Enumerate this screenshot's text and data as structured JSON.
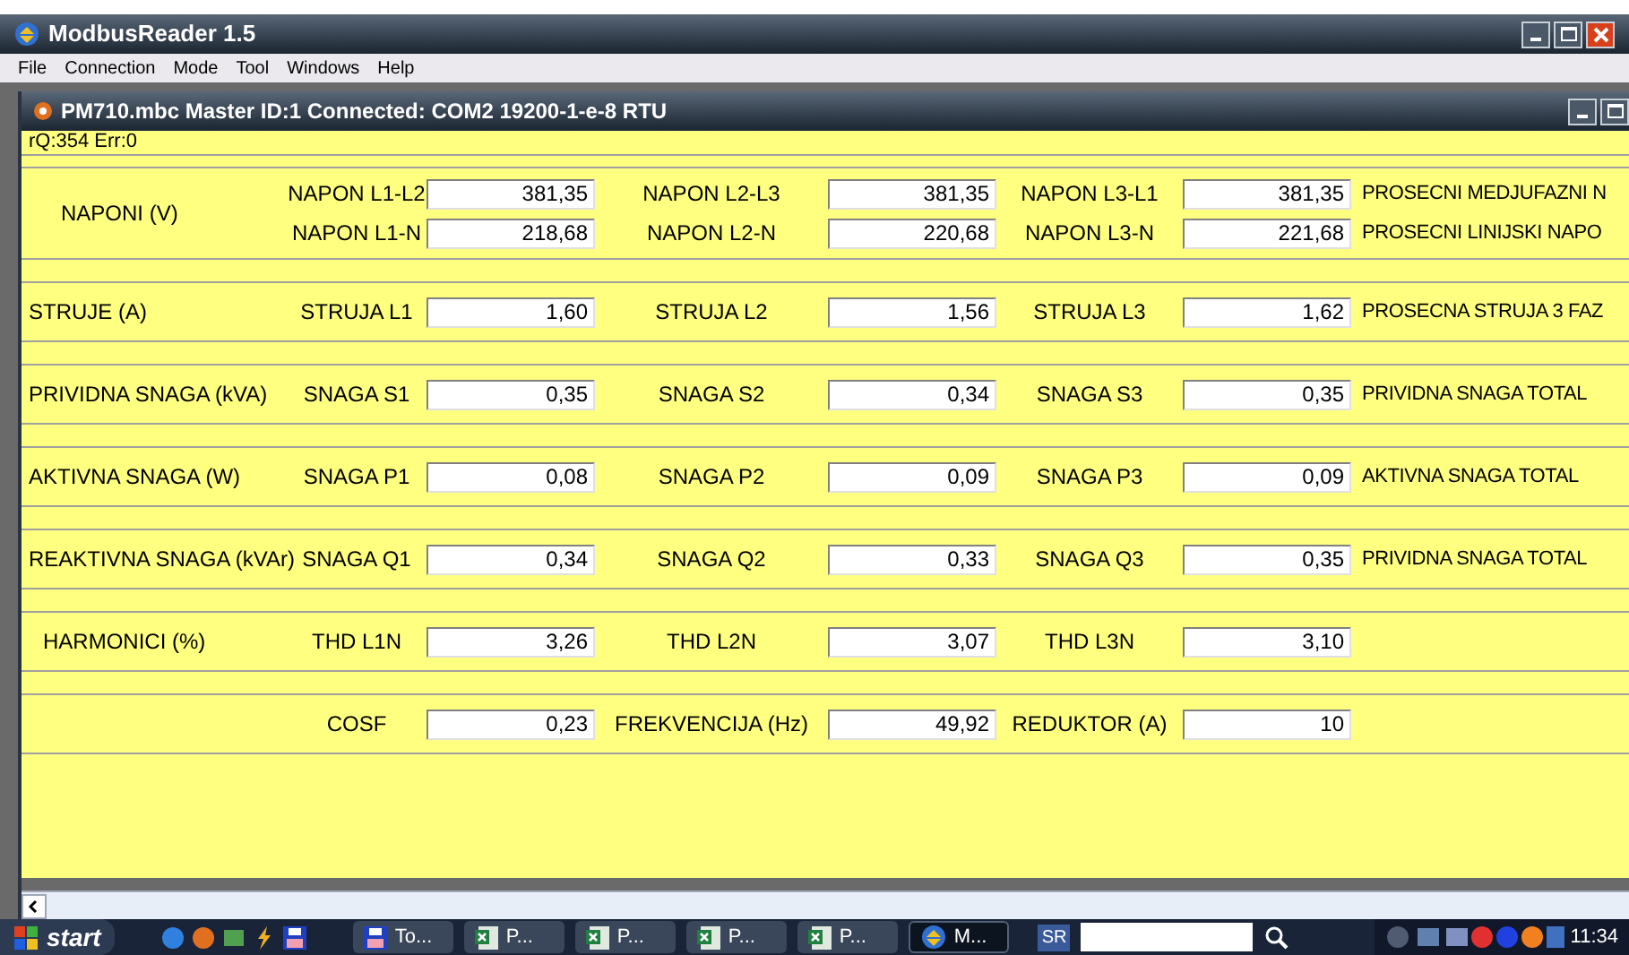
{
  "app_title": "ModbusReader 1.5",
  "menu": [
    "File",
    "Connection",
    "Mode",
    "Tool",
    "Windows",
    "Help"
  ],
  "document": {
    "title": "PM710.mbc Master ID:1 Connected: COM2  19200-1-e-8 RTU",
    "status": "rQ:354 Err:0",
    "sections": [
      {
        "title": "NAPONI (V)",
        "rows": [
          {
            "cells": [
              {
                "label": "NAPON L1-L2",
                "value": "381,35"
              },
              {
                "label": "NAPON L2-L3",
                "value": "381,35"
              },
              {
                "label": "NAPON L3-L1",
                "value": "381,35"
              }
            ],
            "summary": "PROSECNI MEDJUFAZNI N"
          },
          {
            "cells": [
              {
                "label": "NAPON L1-N",
                "value": "218,68"
              },
              {
                "label": "NAPON L2-N",
                "value": "220,68"
              },
              {
                "label": "NAPON L3-N",
                "value": "221,68"
              }
            ],
            "summary": "PROSECNI LINIJSKI NAPO"
          }
        ]
      },
      {
        "title": "STRUJE (A)",
        "rows": [
          {
            "cells": [
              {
                "label": "STRUJA L1",
                "value": "1,60"
              },
              {
                "label": "STRUJA L2",
                "value": "1,56"
              },
              {
                "label": "STRUJA L3",
                "value": "1,62"
              }
            ],
            "summary": "PROSECNA STRUJA 3 FAZ"
          }
        ]
      },
      {
        "title": "PRIVIDNA SNAGA (kVA)",
        "rows": [
          {
            "cells": [
              {
                "label": "SNAGA S1",
                "value": "0,35"
              },
              {
                "label": "SNAGA S2",
                "value": "0,34"
              },
              {
                "label": "SNAGA S3",
                "value": "0,35"
              }
            ],
            "summary": "PRIVIDNA SNAGA TOTAL"
          }
        ]
      },
      {
        "title": "AKTIVNA SNAGA (W)",
        "rows": [
          {
            "cells": [
              {
                "label": "SNAGA P1",
                "value": "0,08"
              },
              {
                "label": "SNAGA P2",
                "value": "0,09"
              },
              {
                "label": "SNAGA P3",
                "value": "0,09"
              }
            ],
            "summary": "AKTIVNA SNAGA TOTAL"
          }
        ]
      },
      {
        "title": "REAKTIVNA SNAGA (kVAr)",
        "rows": [
          {
            "cells": [
              {
                "label": "SNAGA Q1",
                "value": "0,34"
              },
              {
                "label": "SNAGA Q2",
                "value": "0,33"
              },
              {
                "label": "SNAGA Q3",
                "value": "0,35"
              }
            ],
            "summary": "PRIVIDNA SNAGA TOTAL"
          }
        ]
      },
      {
        "title": "HARMONICI (%)",
        "rows": [
          {
            "cells": [
              {
                "label": "THD L1N",
                "value": "3,26"
              },
              {
                "label": "THD L2N",
                "value": "3,07"
              },
              {
                "label": "THD L3N",
                "value": "3,10"
              }
            ]
          }
        ]
      },
      {
        "rows": [
          {
            "cells": [
              {
                "label": "COSF",
                "value": "0,23"
              },
              {
                "label": "FREKVENCIJA (Hz)",
                "value": "49,92"
              },
              {
                "label": "REDUKTOR (A)",
                "value": "10"
              }
            ]
          }
        ]
      }
    ]
  },
  "taskbar": {
    "start": "start",
    "tasks": [
      {
        "kind": "disk",
        "label": "To...",
        "selected": false
      },
      {
        "kind": "sheet",
        "label": "P...",
        "selected": false
      },
      {
        "kind": "sheet",
        "label": "P...",
        "selected": false
      },
      {
        "kind": "sheet",
        "label": "P...",
        "selected": false
      },
      {
        "kind": "sheet",
        "label": "P...",
        "selected": false
      },
      {
        "kind": "app",
        "label": "M...",
        "selected": true
      }
    ],
    "language": "SR",
    "clock": "11:34"
  }
}
